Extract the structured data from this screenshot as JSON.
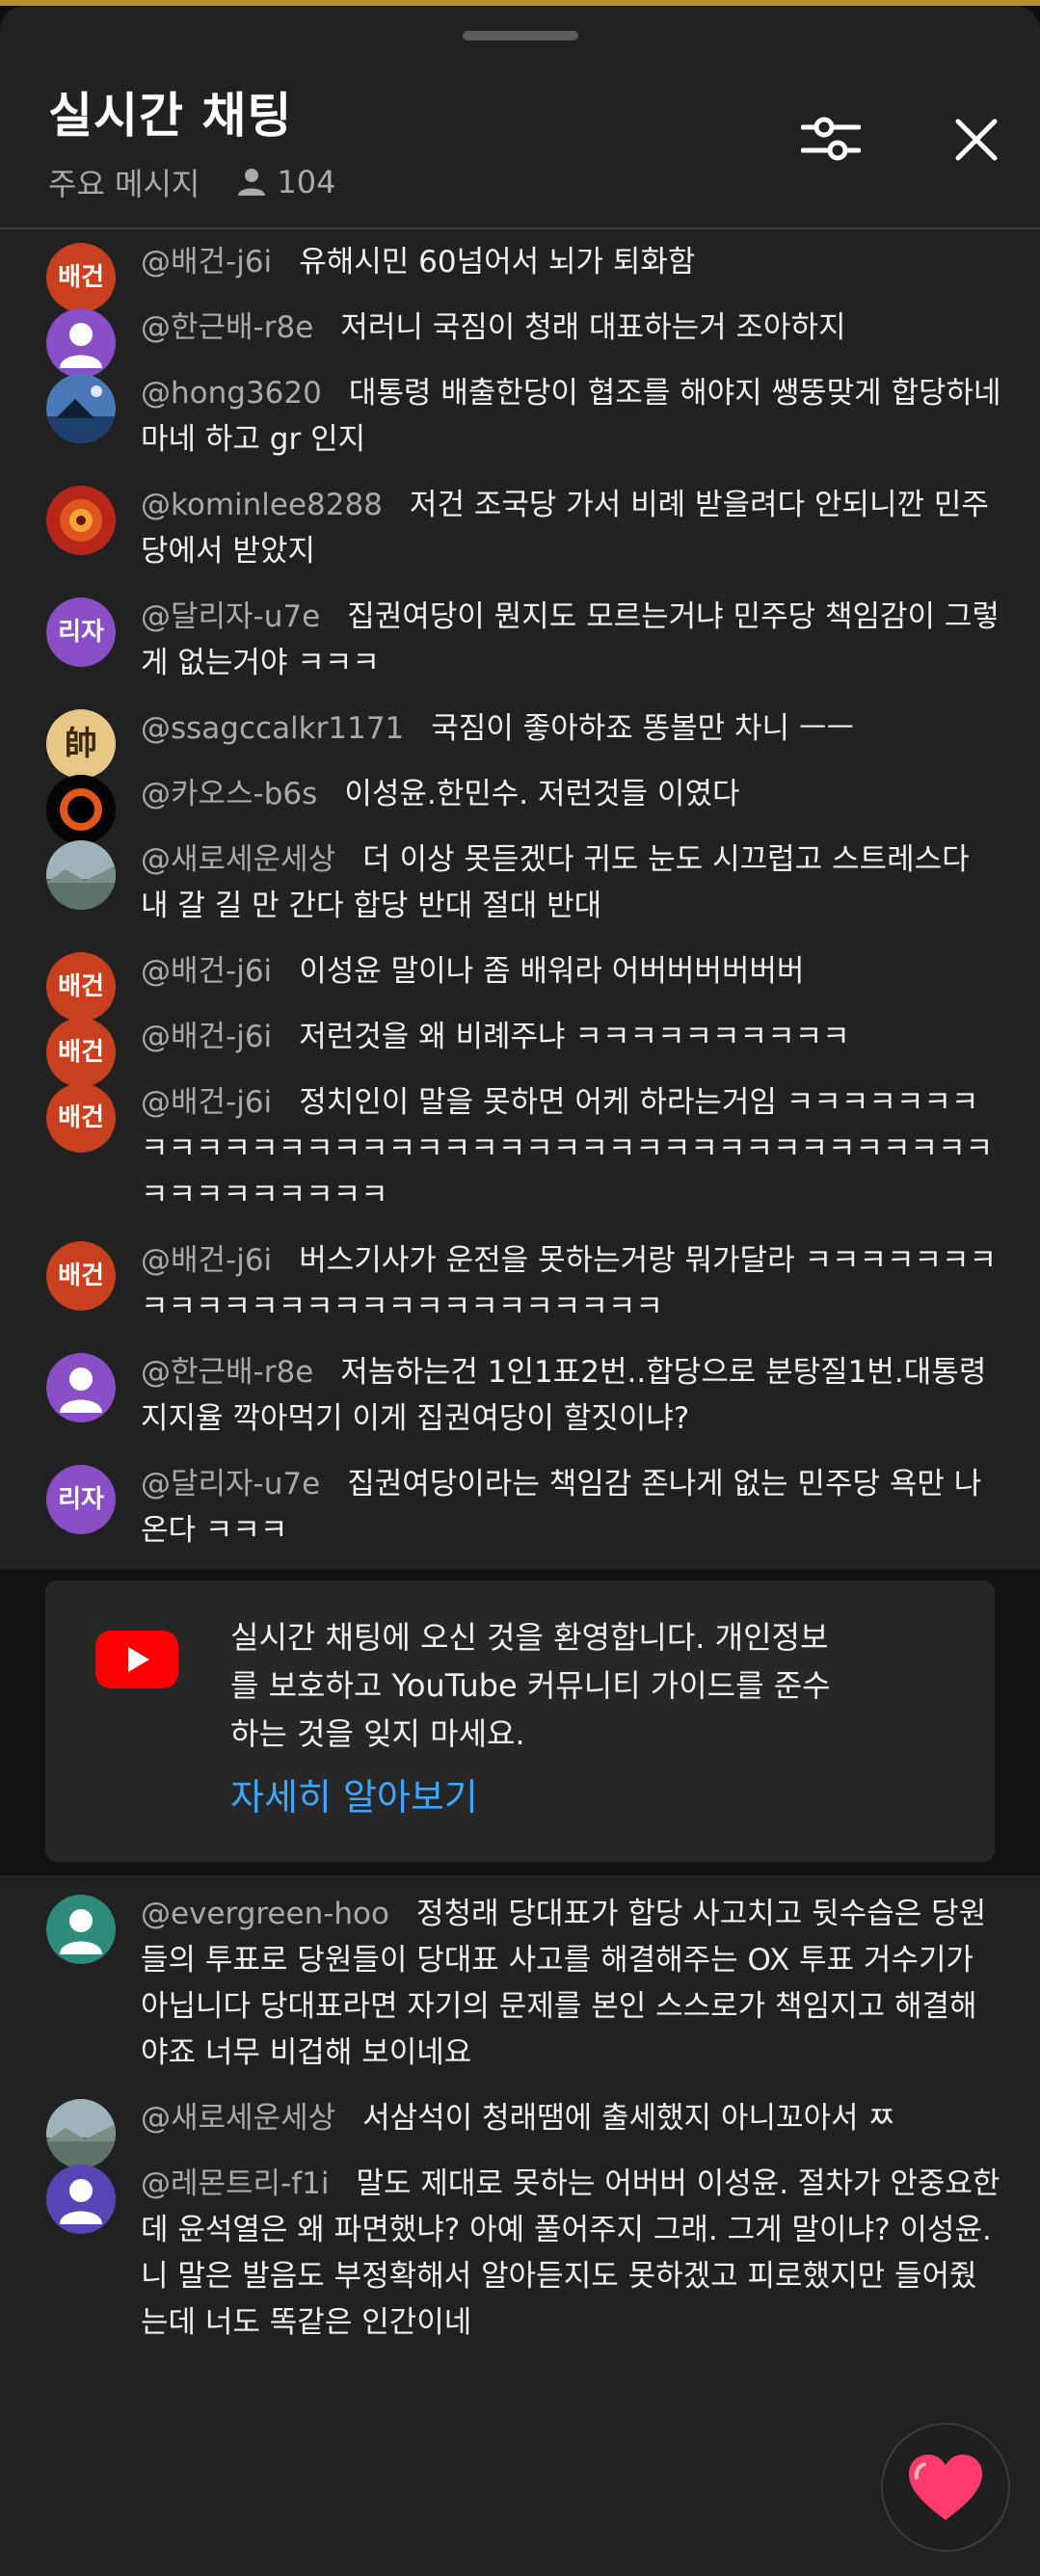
{
  "header": {
    "title": "실시간 채팅",
    "mode_label": "주요 메시지",
    "viewer_count": "104"
  },
  "messages": [
    {
      "author": "@배건-j6i",
      "text": "유해시민 60넘어서 뇌가 퇴화함",
      "avatar_text": "배건",
      "avatar_color": "#c8401d"
    },
    {
      "author": "@한근배-r8e",
      "text": "저러니 국짐이 청래 대표하는거 조아하지",
      "avatar_color": "#8a4ec6"
    },
    {
      "author": "@hong3620",
      "text": "대통령 배출한당이 협조를 해야지 쌩뚱맞게 합당하네 마네 하고 gr 인지",
      "avatar_color": "#3f6fa8"
    },
    {
      "author": "@kominlee8288",
      "text": "저건 조국당 가서 비례 받을려다 안되니깐 민주당에서 받았지",
      "avatar_color": "#b8261a"
    },
    {
      "author": "@달리자-u7e",
      "text": "집권여당이 뭔지도 모르는거냐 민주당 책임감이 그렇게 없는거야 ㅋㅋㅋ",
      "avatar_text": "리자",
      "avatar_color": "#8a4ec6"
    },
    {
      "author": "@ssagccalkr1171",
      "text": "국짐이 좋아하죠 똥볼만 차니 ㅡㅡ",
      "avatar_text": "帥",
      "avatar_color": "#e7c686"
    },
    {
      "author": "@카오스-b6s",
      "text": "이성윤.한민수. 저런것들 이였다",
      "avatar_color": "#050505"
    },
    {
      "author": "@새로세운세상",
      "text": "더 이상 못듣겠다 귀도 눈도 시끄럽고 스트레스다 내 갈 길 만 간다 합당 반대 절대 반대",
      "avatar_color": "#7a8f96"
    },
    {
      "author": "@배건-j6i",
      "text": "이성윤 말이나 좀 배워라 어버버버버버버",
      "avatar_text": "배건",
      "avatar_color": "#c8401d"
    },
    {
      "author": "@배건-j6i",
      "text": "저런것을 왜 비례주냐 ㅋㅋㅋㅋㅋㅋㅋㅋㅋㅋ",
      "avatar_text": "배건",
      "avatar_color": "#c8401d"
    },
    {
      "author": "@배건-j6i",
      "text": "정치인이 말을 못하면 어케 하라는거임 ㅋㅋㅋㅋㅋㅋㅋㅋㅋㅋㅋㅋㅋㅋㅋㅋㅋㅋㅋㅋㅋㅋㅋㅋㅋㅋㅋㅋㅋㅋㅋㅋㅋㅋㅋㅋㅋㅋㅋㅋㅋㅋㅋㅋㅋㅋㅋ",
      "avatar_text": "배건",
      "avatar_color": "#c8401d"
    },
    {
      "author": "@배건-j6i",
      "text": "버스기사가 운전을 못하는거랑 뭐가달라 ㅋㅋㅋㅋㅋㅋㅋㅋㅋㅋㅋㅋㅋㅋㅋㅋㅋㅋㅋㅋㅋㅋㅋㅋㅋㅋ",
      "avatar_text": "배건",
      "avatar_color": "#c8401d"
    },
    {
      "author": "@한근배-r8e",
      "text": "저놈하는건 1인1표2번..합당으로 분탕질1번.대통령지지율 깍아먹기 이게 집권여당이 할짓이냐?",
      "avatar_color": "#8a4ec6"
    },
    {
      "author": "@달리자-u7e",
      "text": "집권여당이라는 책임감 존나게 없는 민주당 욕만 나온다 ㅋㅋㅋ",
      "avatar_text": "리자",
      "avatar_color": "#8a4ec6"
    }
  ],
  "welcome": {
    "text": "실시간 채팅에 오신 것을 환영합니다. 개인정보를 보호하고 YouTube 커뮤니티 가이드를 준수하는 것을 잊지 마세요.",
    "link": "자세히 알아보기"
  },
  "messages_after": [
    {
      "author": "@evergreen-hoo",
      "text": "정청래 당대표가 합당 사고치고 뒷수습은 당원들의 투표로 당원들이 당대표 사고를 해결해주는 OX 투표 거수기가 아닙니다 당대표라면 자기의 문제를 본인 스스로가 책임지고 해결해야죠 너무 비겁해 보이네요",
      "avatar_color": "#2e8b7a"
    },
    {
      "author": "@새로세운세상",
      "text": "서삼석이 청래땜에 출세했지 아니꼬아서 ㅉ",
      "avatar_color": "#7a8f96"
    },
    {
      "author": "@레몬트리-f1i",
      "text": "말도 제대로 못하는 어버버 이성윤. 절차가 안중요한데 윤석열은 왜 파면했냐? 아예 풀어주지 그래. 그게 말이냐? 이성윤. 니 말은 발음도 부정확해서 알아듣지도 못하겠고 피로했지만 들어줬는데 너도 똑같은 인간이네",
      "avatar_color": "#5845b5"
    }
  ],
  "icons": {
    "filter": "tune-icon",
    "close": "close-icon",
    "viewers": "person-icon",
    "youtube": "youtube-logo-icon",
    "reaction": "heart-icon"
  },
  "colors": {
    "background": "#212121",
    "link": "#3ea6ff",
    "youtube_red": "#ff0000",
    "heart": "#ff3b6b"
  }
}
